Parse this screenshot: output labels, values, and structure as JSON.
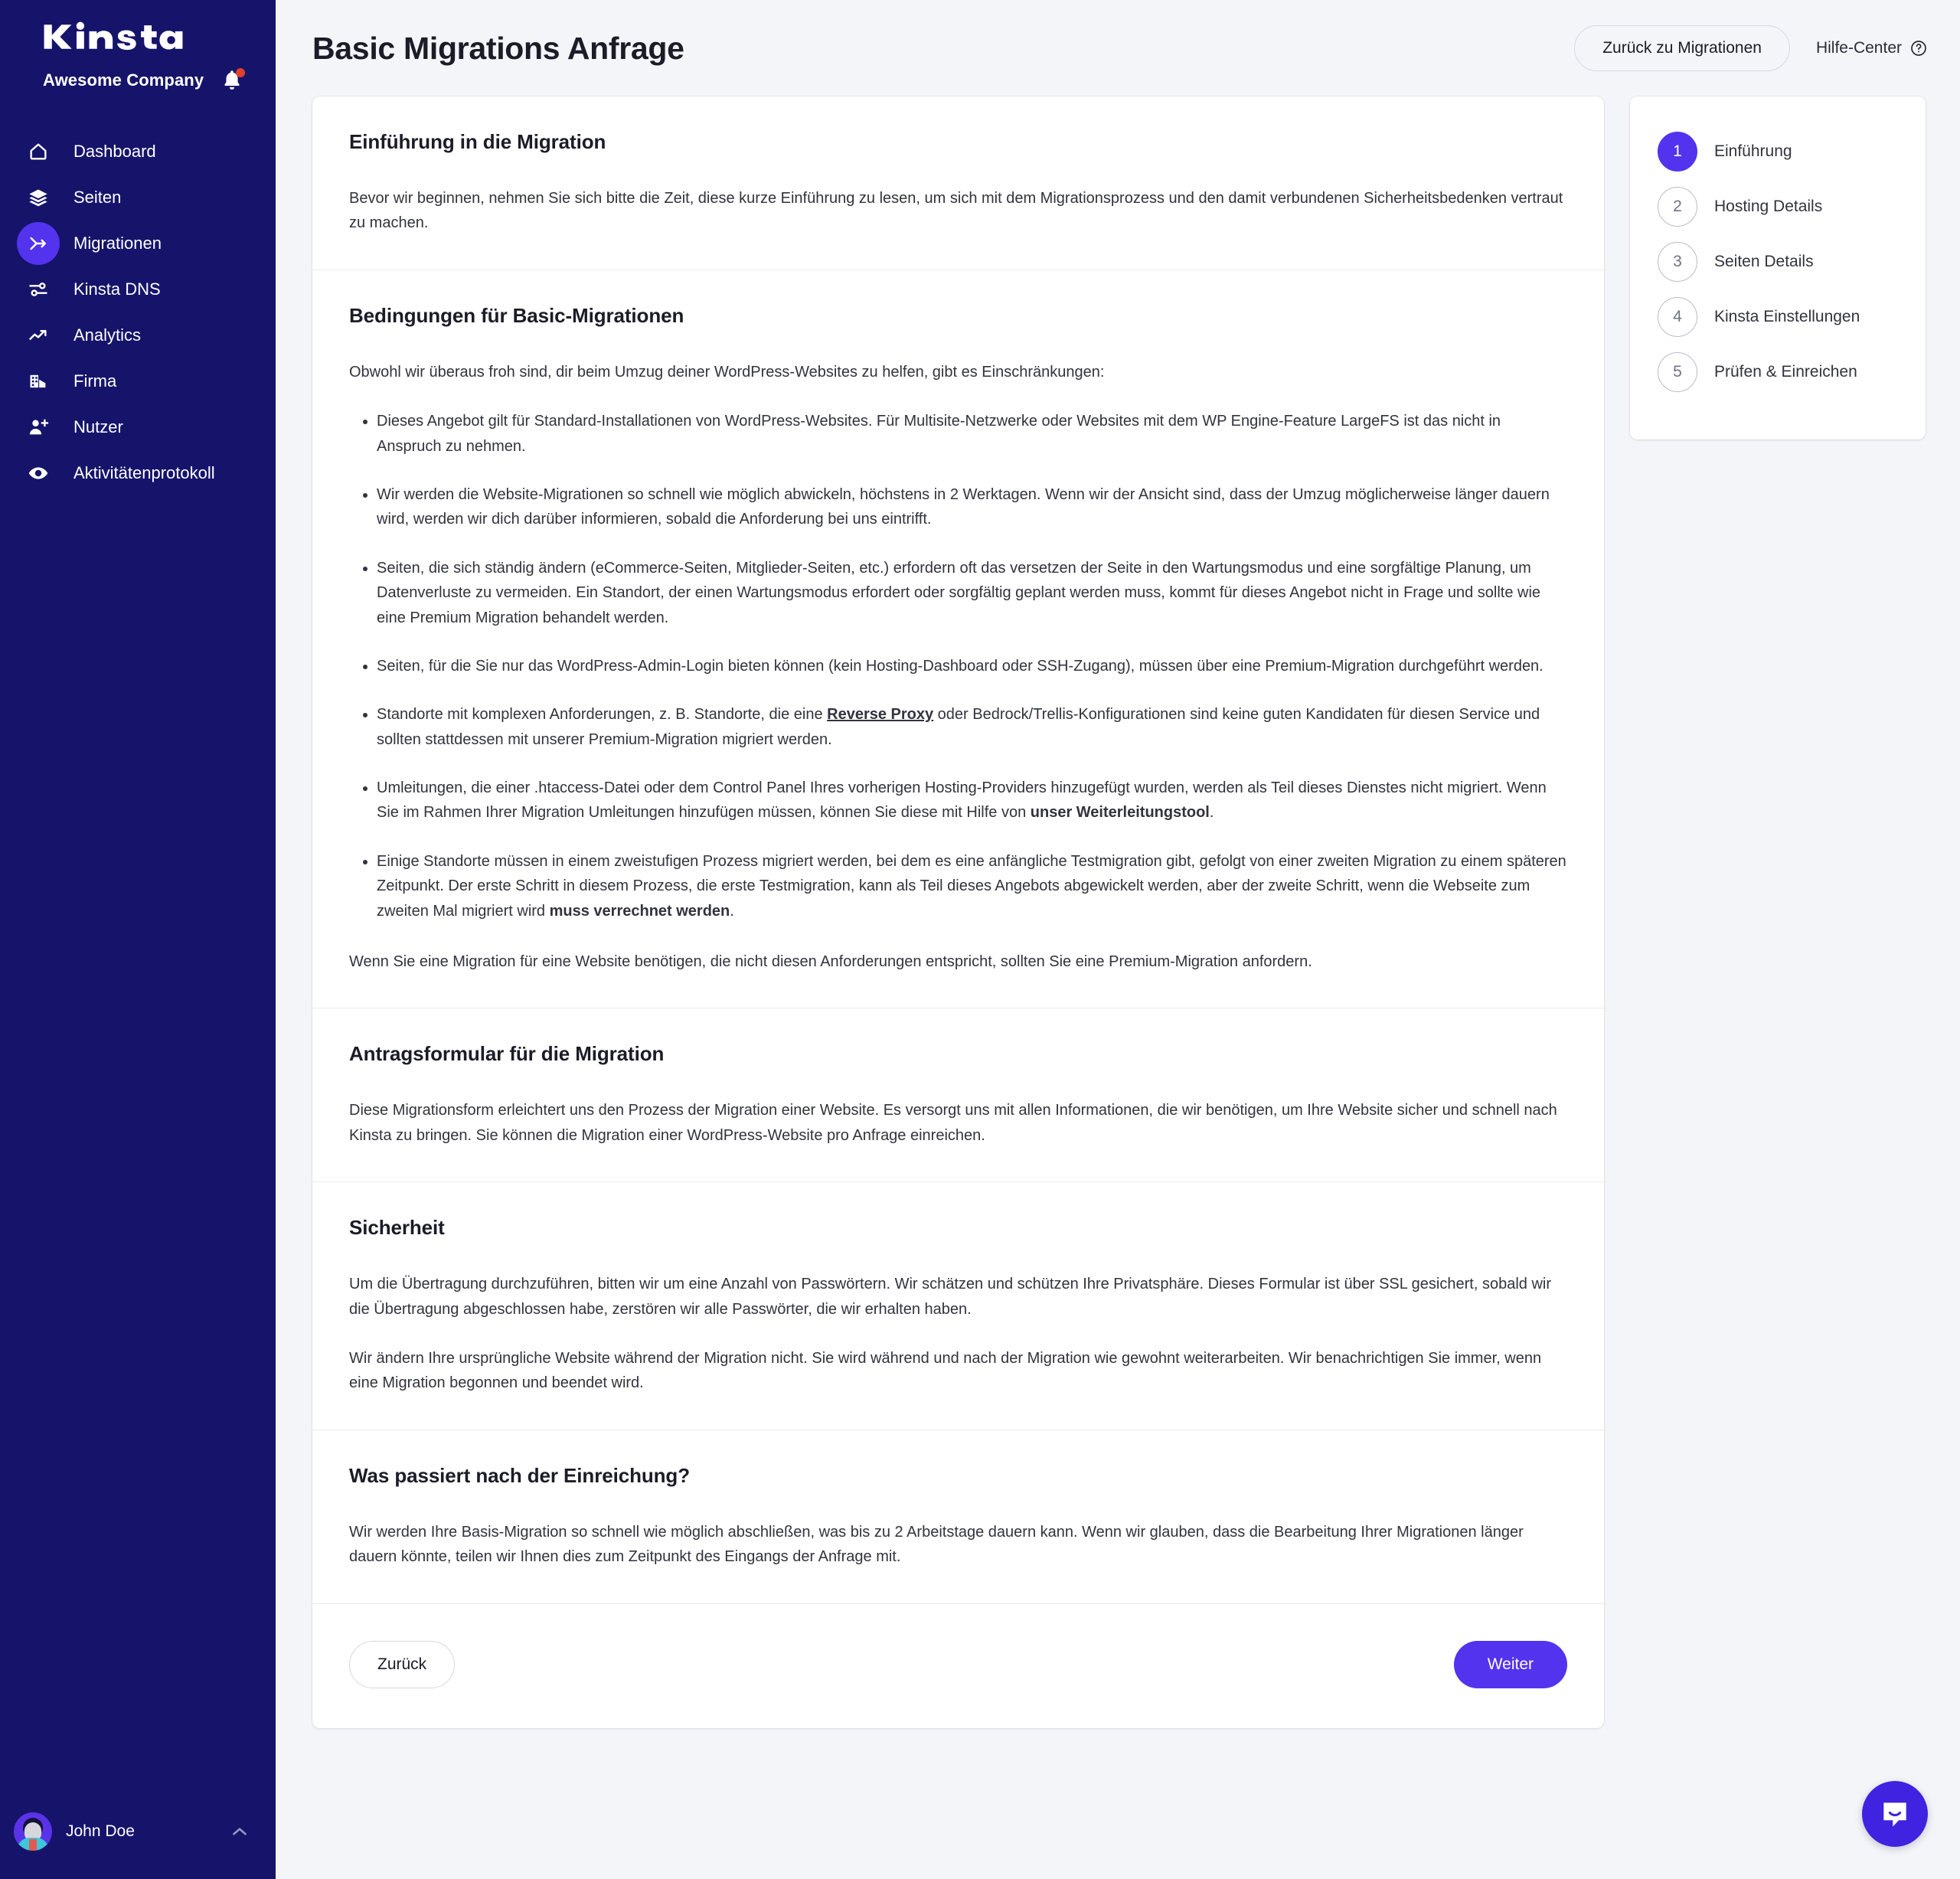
{
  "sidebar": {
    "logo_text": "kinsta",
    "org_name": "Awesome Company",
    "notification_icon": "bell-icon",
    "items": [
      {
        "label": "Dashboard",
        "icon": "home-icon",
        "active": false
      },
      {
        "label": "Seiten",
        "icon": "layers-icon",
        "active": false
      },
      {
        "label": "Migrationen",
        "icon": "migration-icon",
        "active": true
      },
      {
        "label": "Kinsta DNS",
        "icon": "dns-icon",
        "active": false
      },
      {
        "label": "Analytics",
        "icon": "trend-up-icon",
        "active": false
      },
      {
        "label": "Firma",
        "icon": "building-icon",
        "active": false
      },
      {
        "label": "Nutzer",
        "icon": "user-add-icon",
        "active": false
      },
      {
        "label": "Aktivitätenprotokoll",
        "icon": "eye-icon",
        "active": false
      }
    ],
    "user": {
      "name": "John Doe",
      "chevron_icon": "chevron-up-icon"
    }
  },
  "header": {
    "title": "Basic Migrations Anfrage",
    "back_button": "Zurück zu Migrationen",
    "help_link": "Hilfe-Center",
    "help_icon": "question-circle-icon"
  },
  "sections": {
    "intro": {
      "title": "Einführung in die Migration",
      "paragraph": "Bevor wir beginnen, nehmen Sie sich bitte die Zeit, diese kurze Einführung zu lesen, um sich mit dem Migrationsprozess und den damit verbundenen Sicherheitsbedenken vertraut zu machen."
    },
    "terms": {
      "title": "Bedingungen für Basic-Migrationen",
      "lead": "Obwohl wir überaus froh sind, dir beim Umzug deiner WordPress-Websites zu helfen, gibt es Einschränkungen:",
      "bullets": [
        {
          "text": "Dieses Angebot gilt für Standard-Installationen von WordPress-Websites. Für Multisite-Netzwerke oder Websites mit dem WP Engine-Feature LargeFS ist das nicht in Anspruch zu nehmen."
        },
        {
          "text": "Wir werden die Website-Migrationen so schnell wie möglich abwickeln, höchstens in 2 Werktagen. Wenn wir der Ansicht sind, dass der Umzug möglicherweise länger dauern wird, werden wir dich darüber informieren, sobald die Anforderung bei uns eintrifft."
        },
        {
          "text": "Seiten, die sich ständig ändern (eCommerce-Seiten, Mitglieder-Seiten, etc.) erfordern oft das versetzen der Seite in den Wartungsmodus und eine sorgfältige Planung, um Datenverluste zu vermeiden. Ein Standort, der einen Wartungsmodus erfordert oder sorgfältig geplant werden muss, kommt für dieses Angebot nicht in Frage und sollte wie eine Premium Migration behandelt werden."
        },
        {
          "text": "Seiten, für die Sie nur das WordPress-Admin-Login bieten können (kein Hosting-Dashboard oder SSH-Zugang), müssen über eine Premium-Migration durchgeführt werden."
        },
        {
          "pre": "Standorte mit komplexen Anforderungen, z. B. Standorte, die eine ",
          "link": "Reverse Proxy",
          "post": " oder Bedrock/Trellis-Konfigurationen sind keine guten Kandidaten für diesen Service und sollten stattdessen mit unserer Premium-Migration migriert werden."
        },
        {
          "pre": "Umleitungen, die einer .htaccess-Datei oder dem Control Panel Ihres vorherigen Hosting-Providers hinzugefügt wurden, werden als Teil dieses Dienstes nicht migriert. Wenn Sie im Rahmen Ihrer Migration Umleitungen hinzufügen müssen, können Sie diese mit Hilfe von ",
          "strong": "unser Weiterleitungstool",
          "post": "."
        },
        {
          "pre": "Einige Standorte müssen in einem zweistufigen Prozess migriert werden, bei dem es eine anfängliche Testmigration gibt, gefolgt von einer zweiten Migration zu einem späteren Zeitpunkt. Der erste Schritt in diesem Prozess, die erste Testmigration, kann als Teil dieses Angebots abgewickelt werden, aber der zweite Schritt, wenn die Webseite zum zweiten Mal migriert wird ",
          "strong": "muss verrechnet werden",
          "post": "."
        }
      ],
      "closing": "Wenn Sie eine Migration für eine Website benötigen, die nicht diesen Anforderungen entspricht, sollten Sie eine Premium-Migration anfordern."
    },
    "form": {
      "title": "Antragsformular für die Migration",
      "paragraph": "Diese Migrationsform erleichtert uns den Prozess der Migration einer Website. Es versorgt uns mit allen Informationen, die wir benötigen, um Ihre Website sicher und schnell nach Kinsta zu bringen. Sie können die Migration einer WordPress-Website pro Anfrage einreichen."
    },
    "security": {
      "title": "Sicherheit",
      "paragraph1": "Um die Übertragung durchzuführen, bitten wir um eine Anzahl von Passwörtern. Wir schätzen und schützen Ihre Privatsphäre. Dieses Formular ist über SSL gesichert, sobald wir die Übertragung abgeschlossen habe, zerstören wir alle Passwörter, die wir erhalten haben.",
      "paragraph2": "Wir ändern Ihre ursprüngliche Website während der Migration nicht. Sie wird während und nach der Migration wie gewohnt weiterarbeiten. Wir benachrichtigen Sie immer, wenn eine Migration begonnen und beendet wird."
    },
    "after": {
      "title": "Was passiert nach der Einreichung?",
      "paragraph": "Wir werden Ihre Basis-Migration so schnell wie möglich abschließen, was bis zu 2 Arbeitstage dauern kann. Wenn wir glauben, dass die Bearbeitung Ihrer Migrationen länger dauern könnte, teilen wir Ihnen dies zum Zeitpunkt des Eingangs der Anfrage mit."
    }
  },
  "actions": {
    "back_label": "Zurück",
    "next_label": "Weiter"
  },
  "stepper": {
    "steps": [
      {
        "number": "1",
        "label": "Einführung",
        "active": true
      },
      {
        "number": "2",
        "label": "Hosting Details",
        "active": false
      },
      {
        "number": "3",
        "label": "Seiten Details",
        "active": false
      },
      {
        "number": "4",
        "label": "Kinsta Einstellungen",
        "active": false
      },
      {
        "number": "5",
        "label": "Prüfen & Einreichen",
        "active": false
      }
    ]
  },
  "intercom": {
    "icon": "chat-bubble-icon"
  },
  "colors": {
    "sidebar_bg": "#16146a",
    "accent": "#5333ed",
    "page_bg": "#f4f5f9",
    "notification_dot": "#e0402c"
  }
}
